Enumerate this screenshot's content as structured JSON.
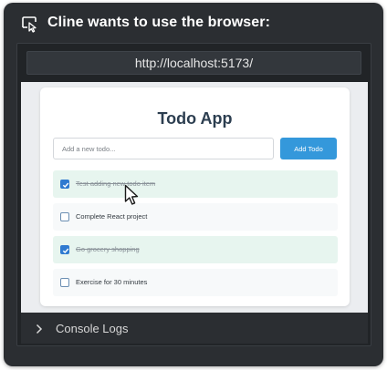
{
  "header": {
    "title": "Cline wants to use the browser:",
    "icon": "browser-cursor-icon"
  },
  "browser": {
    "url": "http://localhost:5173/"
  },
  "app": {
    "title": "Todo App",
    "input_placeholder": "Add a new todo...",
    "add_button": "Add Todo",
    "todos": [
      {
        "text": "Test adding new todo item",
        "completed": true
      },
      {
        "text": "Complete React project",
        "completed": false
      },
      {
        "text": "Go grocery shopping",
        "completed": true
      },
      {
        "text": "Exercise for 30 minutes",
        "completed": false
      }
    ]
  },
  "console": {
    "label": "Console Logs",
    "icon": "chevron-right-icon"
  },
  "colors": {
    "frame_bg": "#2b2e32",
    "accent": "#3498db",
    "done_bg": "#e7f5ef"
  }
}
